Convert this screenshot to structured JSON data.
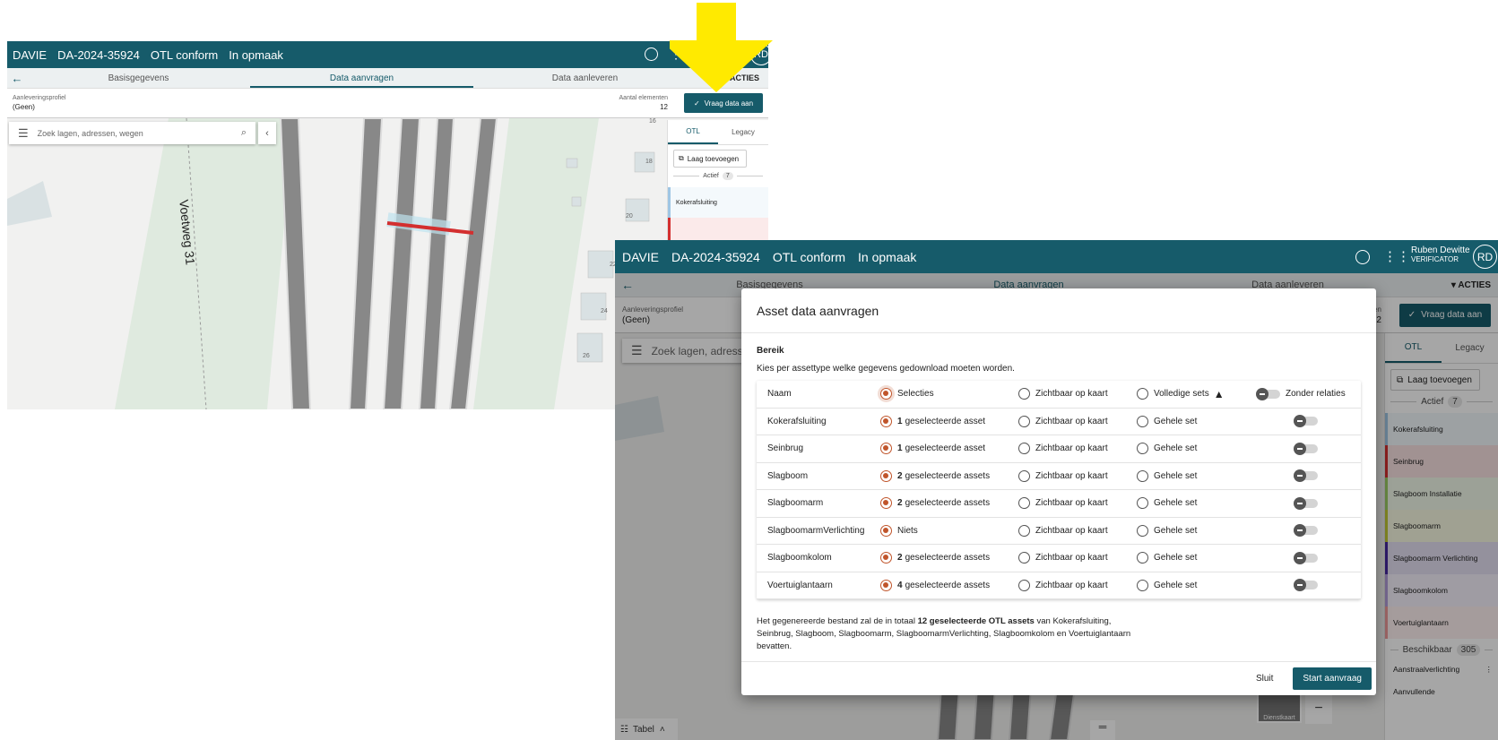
{
  "app": {
    "brand": "DAVIE",
    "delivery_id": "DA-2024-35924",
    "status_otl": "OTL conform",
    "status_edit": "In opmaak",
    "user_name": "Ruben Dewitte",
    "user_role": "VERIFICATOR",
    "user_initials": "RD",
    "user_name_partial": "R"
  },
  "tabs": [
    "Basisgegevens",
    "Data aanvragen",
    "Data aanleveren"
  ],
  "actions_label": "ACTIES",
  "subbar": {
    "profile_label": "Aanleveringsprofiel",
    "profile_value": "(Geen)",
    "count_label": "Aantal elementen",
    "count_label_partial": "en",
    "count_value": "12",
    "count_value_partial": "12",
    "request_button": "Vraag data aan"
  },
  "search": {
    "placeholder": "Zoek lagen, adressen, wegen",
    "placeholder_partial": "Zoek lagen, adresser"
  },
  "map": {
    "street_label": "Voetweg 31",
    "house_numbers": [
      "16",
      "18",
      "20",
      "22",
      "24",
      "26"
    ],
    "basemap_label": "Dienstkaart",
    "table_toggle": "Tabel"
  },
  "layer_panel": {
    "tab_otl": "OTL",
    "tab_legacy": "Legacy",
    "add_layer": "Laag toevoegen",
    "active_label": "Actief",
    "active_count": "7",
    "available_label": "Beschikbaar",
    "available_count": "305",
    "layers": [
      {
        "name": "Kokerafsluiting",
        "color": "#9fc6e4"
      },
      {
        "name": "Seinbrug",
        "color": "#d32f2f"
      },
      {
        "name": "Slagboom Installatie",
        "color": "#9ccc65"
      },
      {
        "name": "Slagboomarm",
        "color": "#c0ca33"
      },
      {
        "name": "Slagboomarm Verlichting",
        "color": "#4527a0"
      },
      {
        "name": "Slagboomkolom",
        "color": "#b39ddb"
      },
      {
        "name": "Voertuiglantaarn",
        "color": "#ef9a9a"
      }
    ],
    "available_layers": [
      "Aanstraalverlichting",
      "Aanvullende"
    ],
    "small_layers": [
      "Kokerafsluiting",
      "Seinbrug"
    ]
  },
  "dialog": {
    "title": "Asset data aanvragen",
    "section": "Bereik",
    "instruction": "Kies per assettype welke gegevens gedownload moeten worden.",
    "header": {
      "name": "Naam",
      "selections": "Selecties",
      "visible": "Zichtbaar op kaart",
      "full_sets": "Volledige sets",
      "without_relations": "Zonder relaties"
    },
    "rows": [
      {
        "name": "Kokerafsluiting",
        "count": "1",
        "text": "geselecteerde asset",
        "visible": "Zichtbaar op kaart",
        "full": "Gehele set"
      },
      {
        "name": "Seinbrug",
        "count": "1",
        "text": "geselecteerde asset",
        "visible": "Zichtbaar op kaart",
        "full": "Gehele set"
      },
      {
        "name": "Slagboom",
        "count": "2",
        "text": "geselecteerde assets",
        "visible": "Zichtbaar op kaart",
        "full": "Gehele set"
      },
      {
        "name": "Slagboomarm",
        "count": "2",
        "text": "geselecteerde assets",
        "visible": "Zichtbaar op kaart",
        "full": "Gehele set"
      },
      {
        "name": "SlagboomarmVerlichting",
        "count": "",
        "text": "Niets",
        "visible": "Zichtbaar op kaart",
        "full": "Gehele set"
      },
      {
        "name": "Slagboomkolom",
        "count": "2",
        "text": "geselecteerde assets",
        "visible": "Zichtbaar op kaart",
        "full": "Gehele set"
      },
      {
        "name": "Voertuiglantaarn",
        "count": "4",
        "text": "geselecteerde assets",
        "visible": "Zichtbaar op kaart",
        "full": "Gehele set"
      }
    ],
    "summary_pre": "Het gegenereerde bestand zal de in totaal ",
    "summary_bold": "12 geselecteerde OTL assets",
    "summary_post": " van Kokerafsluiting, Seinbrug, Slagboom, Slagboomarm, SlagboomarmVerlichting, Slagboomkolom en Voertuiglantaarn bevatten.",
    "close_button": "Sluit",
    "start_button": "Start aanvraag"
  },
  "colors": {
    "primary": "#165b6a",
    "accent_radio": "#c0552b",
    "highlight_arrow": "#ffea00"
  }
}
